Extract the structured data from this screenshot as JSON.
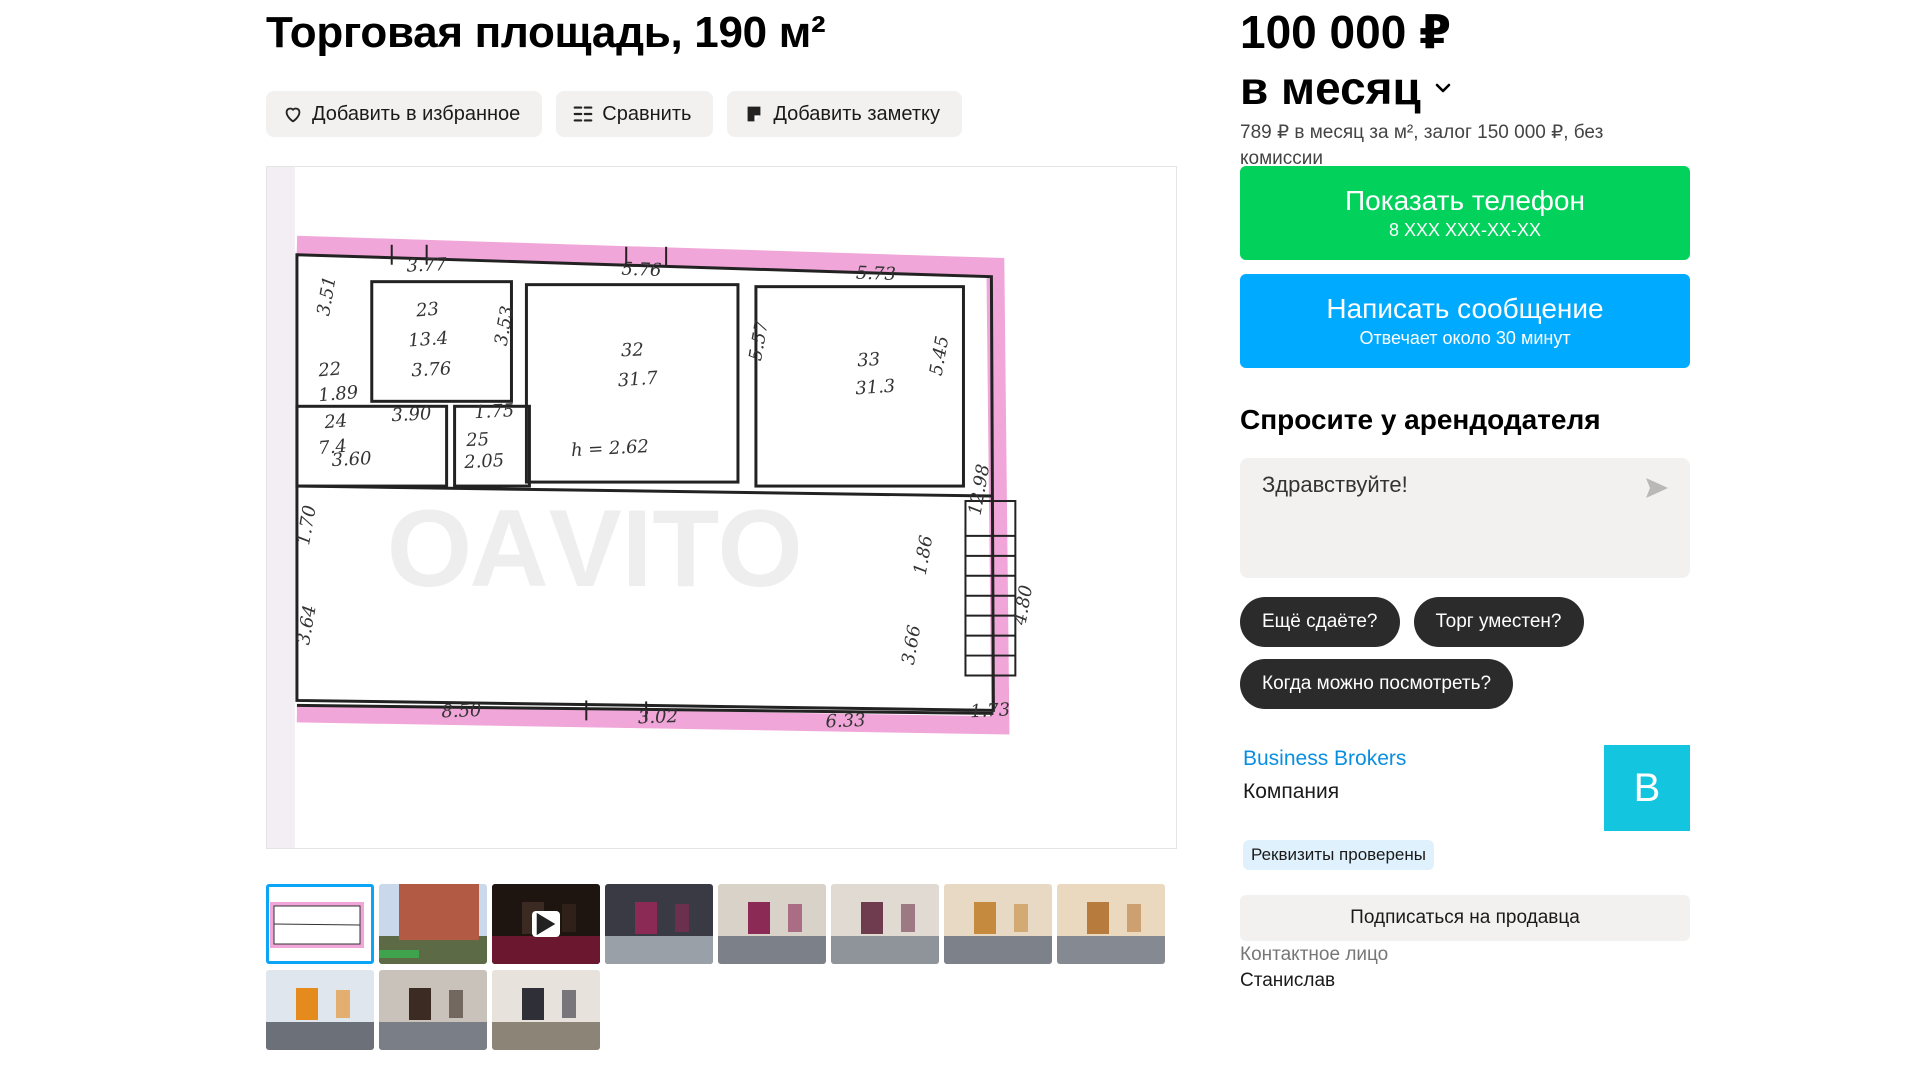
{
  "listing": {
    "title": "Торговая площадь, 190 м²"
  },
  "actions": {
    "favorite": "Добавить в избранное",
    "compare": "Сравнить",
    "note": "Добавить заметку"
  },
  "floorplan": {
    "labels": [
      "3.77",
      "5.76",
      "5.73",
      "3.51",
      "3.53",
      "22",
      "1.89",
      "23",
      "13.4",
      "3.76",
      "32",
      "31.7",
      "5.57",
      "33",
      "31.3",
      "5.45",
      "3.90",
      "1.75",
      "24",
      "7.4",
      "3.60",
      "25",
      "2.05",
      "h = 2.62",
      "1.70",
      "3.64",
      "8.50",
      "3.02",
      "6.33",
      "3.66",
      "1.86",
      "12.98",
      "4.80",
      "1.73"
    ]
  },
  "thumbnails": [
    {
      "name": "floorplan",
      "active": true
    },
    {
      "name": "building-exterior"
    },
    {
      "name": "video",
      "video": true
    },
    {
      "name": "hall-1"
    },
    {
      "name": "hall-2"
    },
    {
      "name": "hall-3"
    },
    {
      "name": "hall-4"
    },
    {
      "name": "hall-5"
    },
    {
      "name": "hall-6"
    },
    {
      "name": "hall-7"
    },
    {
      "name": "hall-8"
    }
  ],
  "pricing": {
    "price": "100 000 ₽",
    "period": "в месяц",
    "details": "789 ₽ в месяц за м², залог 150 000 ₽, без комиссии"
  },
  "contact_buttons": {
    "phone_label": "Показать телефон",
    "phone_masked": "8 XXX XXX-XX-XX",
    "message_label": "Написать сообщение",
    "message_sub": "Отвечает около 30 минут"
  },
  "ask": {
    "title": "Спросите у арендодателя",
    "input_value": "Здравствуйте!",
    "chips": [
      "Ещё сдаёте?",
      "Торг уместен?",
      "Когда можно посмотреть?"
    ]
  },
  "seller": {
    "name": "Business Brokers",
    "type": "Компания",
    "avatar_letter": "B",
    "verified": "Реквизиты проверены",
    "subscribe": "Подписаться на продавца",
    "contact_label": "Контактное лицо",
    "contact_name": "Станислав"
  },
  "colors": {
    "green": "#02d15c",
    "blue": "#00aaff",
    "chip": "#2b2b2b",
    "avatar": "#13c5df",
    "link": "#0a8fe0"
  }
}
